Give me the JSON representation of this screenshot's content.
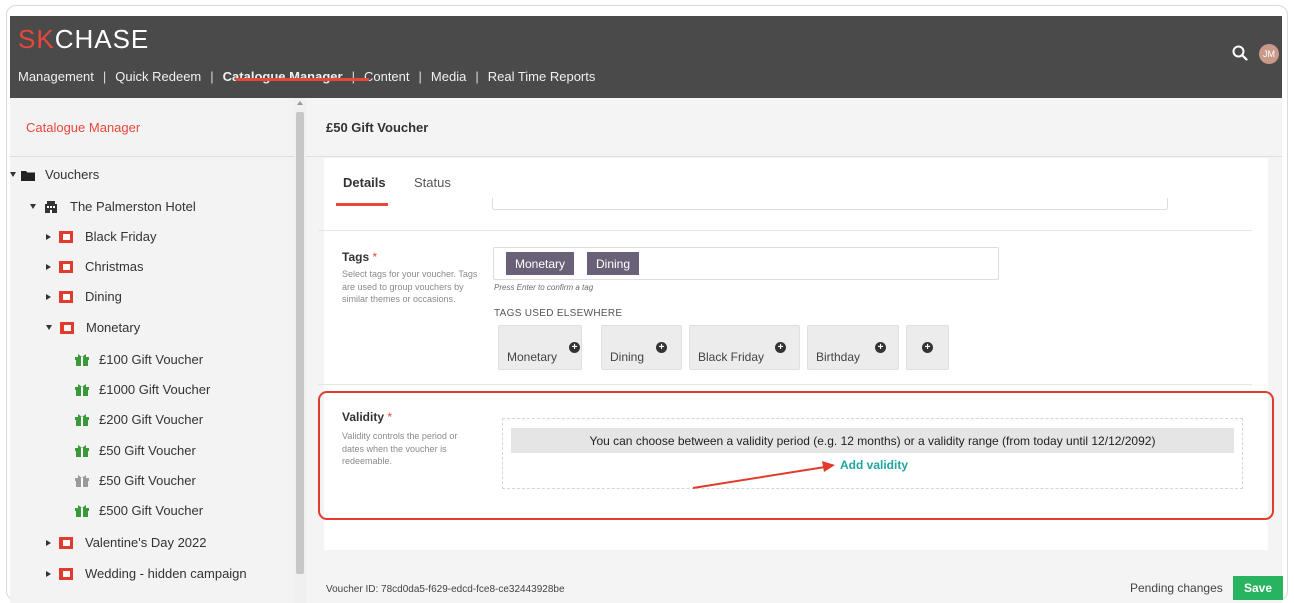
{
  "logo": {
    "accent_part": "SK",
    "rest_part": "CHASE"
  },
  "nav": {
    "items": [
      "Management",
      "Quick Redeem",
      "Catalogue Manager",
      "Content",
      "Media",
      "Real Time Reports"
    ],
    "separator": "|",
    "active": "Catalogue Manager"
  },
  "user": {
    "initials": "JM"
  },
  "sidebar": {
    "title": "Catalogue Manager",
    "tree": [
      {
        "label": "Vouchers",
        "icon": "folder-icon"
      },
      {
        "label": "The Palmerston Hotel",
        "icon": "building-icon"
      },
      {
        "label": "Black Friday",
        "icon": "campaign-icon"
      },
      {
        "label": "Christmas",
        "icon": "campaign-icon"
      },
      {
        "label": "Dining",
        "icon": "campaign-icon"
      },
      {
        "label": "Monetary",
        "icon": "campaign-icon"
      },
      {
        "label": "£100 Gift Voucher",
        "icon": "gift-icon"
      },
      {
        "label": "£1000 Gift Voucher",
        "icon": "gift-icon"
      },
      {
        "label": "£200 Gift Voucher",
        "icon": "gift-icon"
      },
      {
        "label": "£50 Gift Voucher",
        "icon": "gift-icon"
      },
      {
        "label": "£50 Gift Voucher",
        "icon": "gift-icon-grey"
      },
      {
        "label": "£500 Gift Voucher",
        "icon": "gift-icon"
      },
      {
        "label": "Valentine's Day 2022",
        "icon": "campaign-icon"
      },
      {
        "label": "Wedding - hidden campaign",
        "icon": "campaign-icon"
      }
    ]
  },
  "main": {
    "voucher_title": "£50 Gift Voucher",
    "tabs": [
      "Details",
      "Status"
    ],
    "tags": {
      "label": "Tags",
      "required_mark": "*",
      "help": "Select tags for your voucher. Tags are used to group vouchers by similar themes or occasions.",
      "selected": [
        "Monetary",
        "Dining"
      ],
      "hint": "Press Enter to confirm a tag",
      "elsewhere_title": "TAGS USED ELSEWHERE",
      "suggestions": [
        "Monetary",
        "Dining",
        "Black Friday",
        "Birthday",
        ""
      ]
    },
    "validity": {
      "label": "Validity",
      "required_mark": "*",
      "help": "Validity controls the period or dates when the voucher is redeemable.",
      "message": "You can choose between a validity period (e.g. 12 months) or a validity range (from today until 12/12/2092)",
      "add_label": "Add validity"
    }
  },
  "footer": {
    "voucher_id": "Voucher ID: 78cd0da5-f629-edcd-fce8-ce32443928be",
    "pending": "Pending changes",
    "save_label": "Save"
  },
  "colors": {
    "accent": "#e8473a",
    "topbar": "#4a4a4a",
    "tag_chip": "#6a6178",
    "link": "#1fa6a0",
    "save": "#27b35f",
    "gift_green": "#3a9a3a"
  }
}
